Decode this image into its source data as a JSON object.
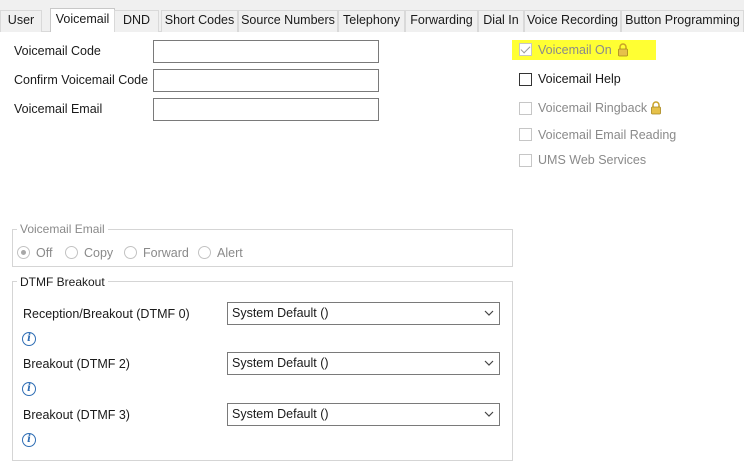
{
  "tabs": [
    {
      "label": "User",
      "active": false
    },
    {
      "label": "Voicemail",
      "active": true
    },
    {
      "label": "DND",
      "active": false
    },
    {
      "label": "Short Codes",
      "active": false
    },
    {
      "label": "Source Numbers",
      "active": false
    },
    {
      "label": "Telephony",
      "active": false
    },
    {
      "label": "Forwarding",
      "active": false
    },
    {
      "label": "Dial In",
      "active": false
    },
    {
      "label": "Voice Recording",
      "active": false
    },
    {
      "label": "Button Programming",
      "active": false
    }
  ],
  "fields": {
    "voicemail_code": {
      "label": "Voicemail Code",
      "value": ""
    },
    "confirm_code": {
      "label": "Confirm Voicemail Code",
      "value": ""
    },
    "email": {
      "label": "Voicemail Email",
      "value": ""
    }
  },
  "checkboxes": {
    "voicemail_on": {
      "label": "Voicemail On",
      "checked": true,
      "enabled": false
    },
    "voicemail_help": {
      "label": "Voicemail Help",
      "checked": false,
      "enabled": true
    },
    "voicemail_ringback": {
      "label": "Voicemail Ringback",
      "checked": false,
      "enabled": false
    },
    "email_reading": {
      "label": "Voicemail Email Reading",
      "checked": false,
      "enabled": false
    },
    "ums": {
      "label": "UMS Web Services",
      "checked": false,
      "enabled": false
    }
  },
  "email_group": {
    "title": "Voicemail Email",
    "options": [
      "Off",
      "Copy",
      "Forward",
      "Alert"
    ],
    "selected": "Off"
  },
  "dtmf": {
    "title": "DTMF Breakout",
    "rows": [
      {
        "label": "Reception/Breakout (DTMF 0)",
        "value": "System Default ()"
      },
      {
        "label": "Breakout (DTMF 2)",
        "value": "System Default ()"
      },
      {
        "label": "Breakout (DTMF 3)",
        "value": "System Default ()"
      }
    ]
  },
  "colors": {
    "highlight": "#ffff33",
    "info": "#2e6db4"
  }
}
